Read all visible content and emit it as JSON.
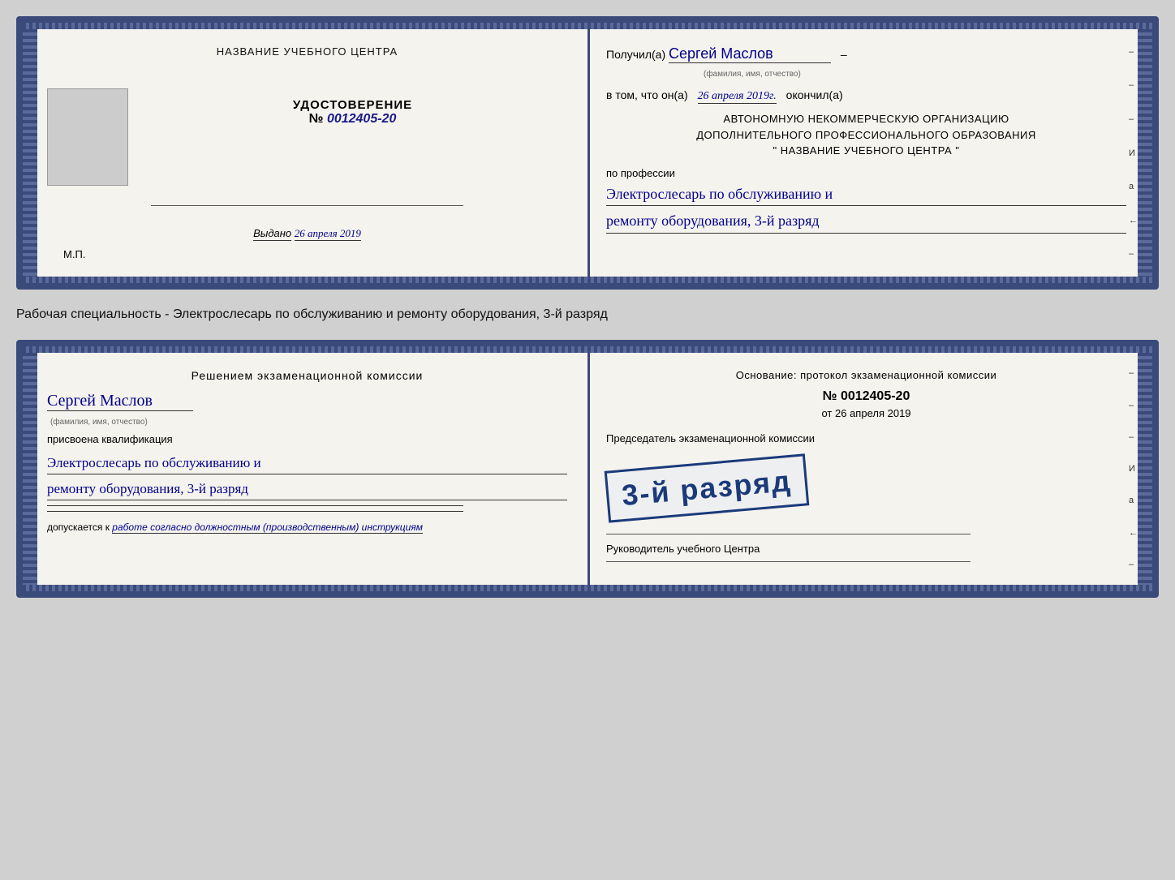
{
  "page": {
    "background": "#d0d0d0"
  },
  "top_card": {
    "left": {
      "institution_name": "НАЗВАНИЕ УЧЕБНОГО ЦЕНТРА",
      "cert_title": "УДОСТОВЕРЕНИЕ",
      "cert_number_label": "№",
      "cert_number": "0012405-20",
      "issued_label": "Выдано",
      "issued_date": "26 апреля 2019",
      "mp_label": "М.П."
    },
    "right": {
      "received_label": "Получил(а)",
      "received_name": "Сергей Маслов",
      "name_subtitle": "(фамилия, имя, отчество)",
      "dash": "–",
      "in_that_label": "в том, что он(а)",
      "date_handwritten": "26 апреля 2019г.",
      "finished_label": "окончил(а)",
      "org_line1": "АВТОНОМНУЮ НЕКОММЕРЧЕСКУЮ ОРГАНИЗАЦИЮ",
      "org_line2": "ДОПОЛНИТЕЛЬНОГО ПРОФЕССИОНАЛЬНОГО ОБРАЗОВАНИЯ",
      "org_line3": "\"   НАЗВАНИЕ УЧЕБНОГО ЦЕНТРА   \"",
      "profession_label": "по профессии",
      "profession_line1": "Электрослесарь по обслуживанию и",
      "profession_line2": "ремонту оборудования, 3-й разряд"
    }
  },
  "label_between": {
    "text": "Рабочая специальность - Электрослесарь по обслуживанию и ремонту оборудования, 3-й разряд"
  },
  "bottom_card": {
    "left": {
      "decision_title": "Решением экзаменационной  комиссии",
      "person_name": "Сергей Маслов",
      "name_subtitle": "(фамилия, имя, отчество)",
      "assigned_text": "присвоена квалификация",
      "qualification_line1": "Электрослесарь по обслуживанию и",
      "qualification_line2": "ремонту оборудования, 3-й разряд",
      "allowed_label": "допускается к",
      "allowed_italic": "работе согласно должностным (производственным) инструкциям"
    },
    "right": {
      "basis_text": "Основание: протокол экзаменационной  комиссии",
      "number_label": "№",
      "protocol_number": "0012405-20",
      "date_prefix": "от",
      "protocol_date": "26 апреля 2019",
      "chairman_label": "Председатель экзаменационной комиссии",
      "stamp_text": "3-й разряд",
      "rukovoditel_label": "Руководитель учебного Центра"
    }
  },
  "right_edge_marks_top": [
    "-",
    "-",
    "-",
    "И",
    "а",
    "←",
    "-"
  ],
  "right_edge_marks_bottom": [
    "-",
    "-",
    "-",
    "И",
    "а",
    "←",
    "-"
  ]
}
